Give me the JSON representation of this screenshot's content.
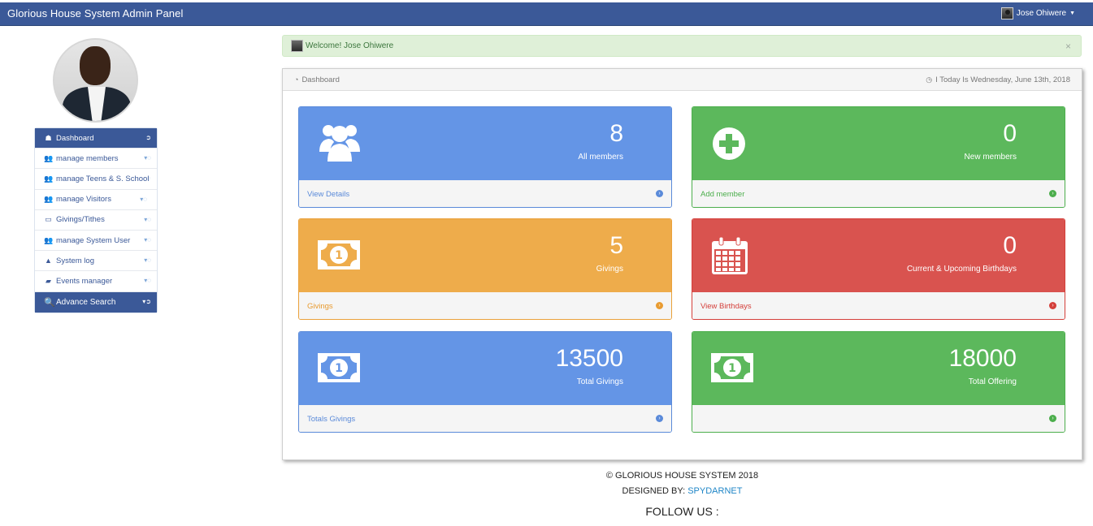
{
  "header": {
    "brand": "Glorious House System Admin Panel",
    "user_name": "Jose Ohiwere"
  },
  "sidebar": {
    "items": [
      {
        "label": "Dashboard",
        "icon": "dashboard-icon"
      },
      {
        "label": "manage members",
        "icon": "users-icon"
      },
      {
        "label": "manage Teens & S. School",
        "icon": "users-icon"
      },
      {
        "label": "manage Visitors",
        "icon": "users-icon"
      },
      {
        "label": "Givings/Tithes",
        "icon": "money-icon"
      },
      {
        "label": "manage System User",
        "icon": "users-icon"
      },
      {
        "label": "System log",
        "icon": "warning-icon"
      },
      {
        "label": "Events manager",
        "icon": "book-icon"
      },
      {
        "label": "Advance Search",
        "icon": "search-icon"
      }
    ]
  },
  "alert": {
    "text": "Welcome! Jose Ohiwere",
    "close": "×"
  },
  "panel": {
    "title": "Dashboard",
    "date": "I Today Is Wednesday, June 13th, 2018"
  },
  "cards": [
    {
      "value": "8",
      "label": "All members",
      "footer": "View Details",
      "color": "#6495e6",
      "icon": "users-icon"
    },
    {
      "value": "0",
      "label": "New members",
      "footer": "Add member",
      "color": "#5cb85c",
      "icon": "plus-circle-icon"
    },
    {
      "value": "5",
      "label": "Givings",
      "footer": "Givings",
      "color": "#eeac4b",
      "icon": "money-icon"
    },
    {
      "value": "0",
      "label": "Current & Upcoming Birthdays",
      "footer": "View Birthdays",
      "color": "#d9534f",
      "icon": "calendar-icon"
    },
    {
      "value": "13500",
      "label": "Total Givings",
      "footer": "Totals Givings",
      "color": "#6495e6",
      "icon": "money-icon"
    },
    {
      "value": "18000",
      "label": "Total Offering",
      "footer": "",
      "color": "#5cb85c",
      "icon": "money-icon"
    }
  ],
  "footer": {
    "copyright": "© GLORIOUS HOUSE SYSTEM 2018",
    "designed_by": "DESIGNED BY:",
    "designer": "SPYDARNET",
    "follow": "FOLLOW US :"
  }
}
